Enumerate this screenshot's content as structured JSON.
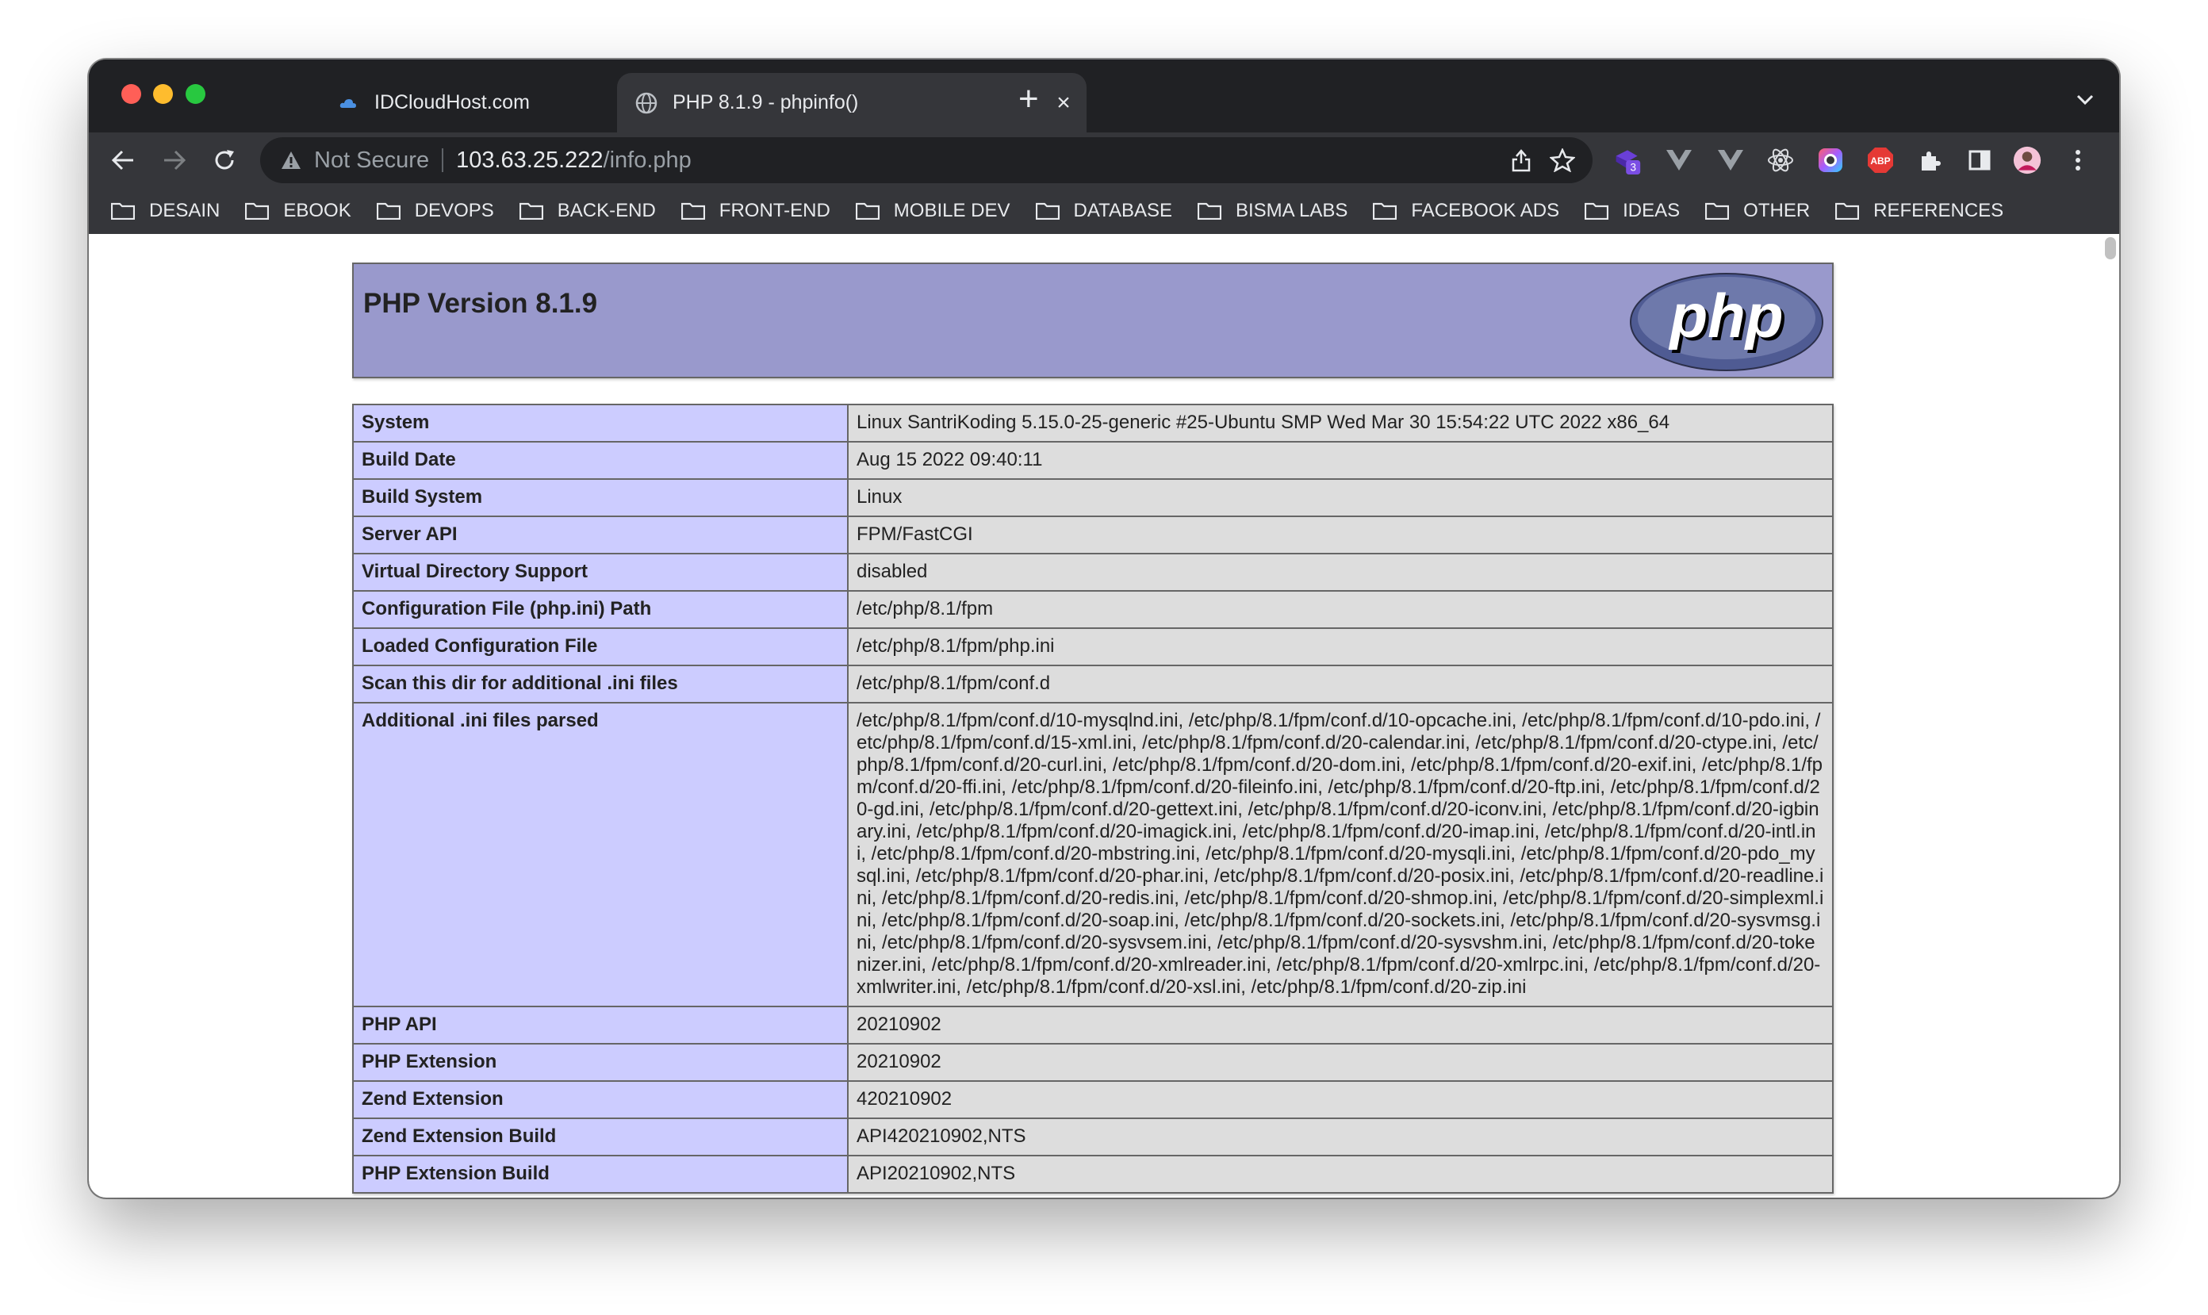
{
  "browser": {
    "tabs": [
      {
        "title": "IDCloudHost.com",
        "active": false
      },
      {
        "title": "PHP 8.1.9 - phpinfo()",
        "active": true
      }
    ],
    "address": {
      "security_label": "Not Secure",
      "host": "103.63.25.222",
      "path": "/info.php"
    },
    "extension_badge": "3",
    "bookmarks": [
      "DESAIN",
      "EBOOK",
      "DEVOPS",
      "BACK-END",
      "FRONT-END",
      "MOBILE DEV",
      "DATABASE",
      "BISMA LABS",
      "FACEBOOK ADS",
      "IDEAS",
      "OTHER",
      "REFERENCES"
    ]
  },
  "phpinfo": {
    "title": "PHP Version 8.1.9",
    "logo_text": "php",
    "rows": [
      {
        "key": "System",
        "value": "Linux SantriKoding 5.15.0-25-generic #25-Ubuntu SMP Wed Mar 30 15:54:22 UTC 2022 x86_64"
      },
      {
        "key": "Build Date",
        "value": "Aug 15 2022 09:40:11"
      },
      {
        "key": "Build System",
        "value": "Linux"
      },
      {
        "key": "Server API",
        "value": "FPM/FastCGI"
      },
      {
        "key": "Virtual Directory Support",
        "value": "disabled"
      },
      {
        "key": "Configuration File (php.ini) Path",
        "value": "/etc/php/8.1/fpm"
      },
      {
        "key": "Loaded Configuration File",
        "value": "/etc/php/8.1/fpm/php.ini"
      },
      {
        "key": "Scan this dir for additional .ini files",
        "value": "/etc/php/8.1/fpm/conf.d"
      },
      {
        "key": "Additional .ini files parsed",
        "value": "/etc/php/8.1/fpm/conf.d/10-mysqlnd.ini, /etc/php/8.1/fpm/conf.d/10-opcache.ini, /etc/php/8.1/fpm/conf.d/10-pdo.ini, /etc/php/8.1/fpm/conf.d/15-xml.ini, /etc/php/8.1/fpm/conf.d/20-calendar.ini, /etc/php/8.1/fpm/conf.d/20-ctype.ini, /etc/php/8.1/fpm/conf.d/20-curl.ini, /etc/php/8.1/fpm/conf.d/20-dom.ini, /etc/php/8.1/fpm/conf.d/20-exif.ini, /etc/php/8.1/fpm/conf.d/20-ffi.ini, /etc/php/8.1/fpm/conf.d/20-fileinfo.ini, /etc/php/8.1/fpm/conf.d/20-ftp.ini, /etc/php/8.1/fpm/conf.d/20-gd.ini, /etc/php/8.1/fpm/conf.d/20-gettext.ini, /etc/php/8.1/fpm/conf.d/20-iconv.ini, /etc/php/8.1/fpm/conf.d/20-igbinary.ini, /etc/php/8.1/fpm/conf.d/20-imagick.ini, /etc/php/8.1/fpm/conf.d/20-imap.ini, /etc/php/8.1/fpm/conf.d/20-intl.ini, /etc/php/8.1/fpm/conf.d/20-mbstring.ini, /etc/php/8.1/fpm/conf.d/20-mysqli.ini, /etc/php/8.1/fpm/conf.d/20-pdo_mysql.ini, /etc/php/8.1/fpm/conf.d/20-phar.ini, /etc/php/8.1/fpm/conf.d/20-posix.ini, /etc/php/8.1/fpm/conf.d/20-readline.ini, /etc/php/8.1/fpm/conf.d/20-redis.ini, /etc/php/8.1/fpm/conf.d/20-shmop.ini, /etc/php/8.1/fpm/conf.d/20-simplexml.ini, /etc/php/8.1/fpm/conf.d/20-soap.ini, /etc/php/8.1/fpm/conf.d/20-sockets.ini, /etc/php/8.1/fpm/conf.d/20-sysvmsg.ini, /etc/php/8.1/fpm/conf.d/20-sysvsem.ini, /etc/php/8.1/fpm/conf.d/20-sysvshm.ini, /etc/php/8.1/fpm/conf.d/20-tokenizer.ini, /etc/php/8.1/fpm/conf.d/20-xmlreader.ini, /etc/php/8.1/fpm/conf.d/20-xmlrpc.ini, /etc/php/8.1/fpm/conf.d/20-xmlwriter.ini, /etc/php/8.1/fpm/conf.d/20-xsl.ini, /etc/php/8.1/fpm/conf.d/20-zip.ini"
      },
      {
        "key": "PHP API",
        "value": "20210902"
      },
      {
        "key": "PHP Extension",
        "value": "20210902"
      },
      {
        "key": "Zend Extension",
        "value": "420210902"
      },
      {
        "key": "Zend Extension Build",
        "value": "API420210902,NTS"
      },
      {
        "key": "PHP Extension Build",
        "value": "API20210902,NTS"
      }
    ]
  },
  "colors": {
    "header_bg": "#9999cc",
    "key_cell_bg": "#ccccff",
    "value_cell_bg": "#dddddd",
    "browser_frame": "#202124",
    "toolbar": "#35363a"
  },
  "icons": [
    "back-arrow-icon",
    "forward-arrow-icon",
    "reload-icon",
    "warning-icon",
    "share-icon",
    "star-icon",
    "extensions-icon",
    "side-panel-icon",
    "profile-avatar",
    "kebab-menu-icon",
    "folder-icon",
    "globe-icon",
    "cloud-icon",
    "close-icon",
    "plus-icon",
    "chevron-down-icon"
  ]
}
